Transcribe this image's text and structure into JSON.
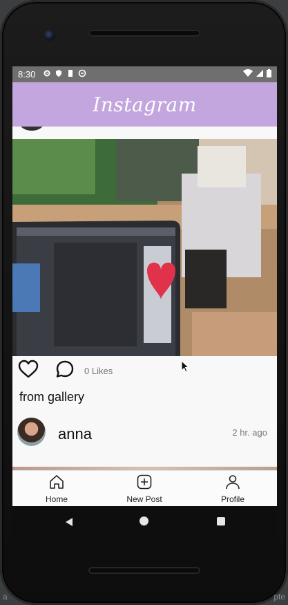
{
  "status_bar": {
    "time": "8:30"
  },
  "app_bar": {
    "title": "Instagram"
  },
  "post": {
    "likes_text": "0 Likes",
    "caption": "from gallery"
  },
  "next_post": {
    "username": "anna",
    "timestamp": "2 hr. ago"
  },
  "bottom_nav": {
    "home_label": "Home",
    "new_post_label": "New Post",
    "profile_label": "Profile"
  },
  "outside": {
    "left_text": "a",
    "right_text": "pte"
  },
  "colors": {
    "app_bar": "#c3a6de",
    "status_bar": "#6f6f6f"
  }
}
